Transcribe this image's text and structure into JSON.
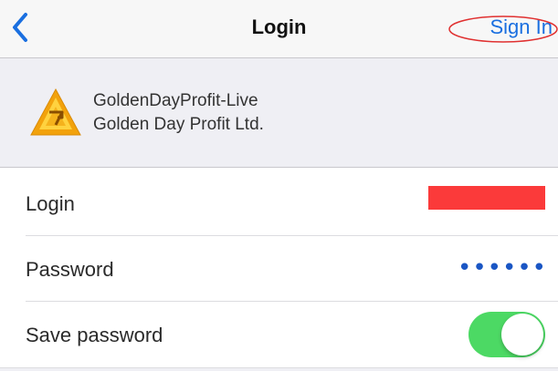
{
  "nav": {
    "title": "Login",
    "back_icon": "chevron-left-icon",
    "sign_in_label": "Sign In",
    "accent_color": "#1a6fe0"
  },
  "server": {
    "logo_icon": "golden-day-logo-icon",
    "name": "GoldenDayProfit-Live",
    "company": "Golden Day Profit Ltd."
  },
  "form": {
    "login": {
      "label": "Login",
      "value_redacted": true,
      "redaction_color": "#fb3a3a"
    },
    "password": {
      "label": "Password",
      "masked_value": "••••••"
    },
    "save_password": {
      "label": "Save password",
      "enabled": true,
      "toggle_color": "#4cd964"
    }
  }
}
